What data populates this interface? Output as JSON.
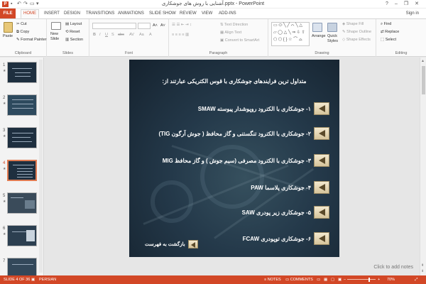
{
  "window": {
    "title": "آشنایی با روش های جوشکاری.pptx - PowerPoint",
    "signin": "Sign in",
    "controls": [
      "?",
      "–",
      "❐",
      "✕"
    ]
  },
  "tabs": {
    "file": "FILE",
    "items": [
      "HOME",
      "INSERT",
      "DESIGN",
      "TRANSITIONS",
      "ANIMATIONS",
      "SLIDE SHOW",
      "REVIEW",
      "VIEW",
      "ADD-INS"
    ],
    "active": "HOME"
  },
  "ribbon": {
    "clipboard": {
      "paste": "Paste",
      "cut": "Cut",
      "copy": "Copy",
      "format_painter": "Format Painter",
      "label": "Clipboard"
    },
    "slides": {
      "new_slide": "New Slide",
      "layout": "Layout",
      "reset": "Reset",
      "section": "Section",
      "label": "Slides"
    },
    "font": {
      "label": "Font"
    },
    "paragraph": {
      "text_direction": "Text Direction",
      "align_text": "Align Text",
      "convert_smartart": "Convert to SmartArt",
      "label": "Paragraph"
    },
    "drawing": {
      "arrange": "Arrange",
      "quick_styles": "Quick Styles",
      "shape_fill": "Shape Fill",
      "shape_outline": "Shape Outline",
      "shape_effects": "Shape Effects",
      "label": "Drawing"
    },
    "editing": {
      "find": "Find",
      "replace": "Replace",
      "select": "Select",
      "label": "Editing"
    }
  },
  "thumbnails": [
    {
      "num": "1"
    },
    {
      "num": "2"
    },
    {
      "num": "3"
    },
    {
      "num": "4",
      "selected": true
    },
    {
      "num": "5"
    },
    {
      "num": "6"
    },
    {
      "num": "7"
    }
  ],
  "slide": {
    "title": "متداول ترین فرایندهای جوشکاری با قوس الکتریکی عبارتند از:",
    "items": [
      "۱- جوشکاری با الکترود روپوشدار پیوسته SMAW",
      "۲- جوشکاری با الکترود تنگستنی و گاز محافظ ( جوش آرگون TIG)",
      "۳- جوشکاری با الکترود مصرفی  (سیم جوش ) و گاز محافظ  MIG",
      "۴- جوشکاری پلاسما PAW",
      "۵- جوشکاری زیر پودری SAW",
      "۶- جوشکاری توپودری  FCAW"
    ],
    "back_link": "بازگشت به فهرست"
  },
  "notes_placeholder": "Click to add notes",
  "status": {
    "slide_info": "SLIDE 4 OF 36",
    "language": "PERSIAN",
    "notes": "NOTES",
    "comments": "COMMENTS",
    "zoom": "70%"
  }
}
